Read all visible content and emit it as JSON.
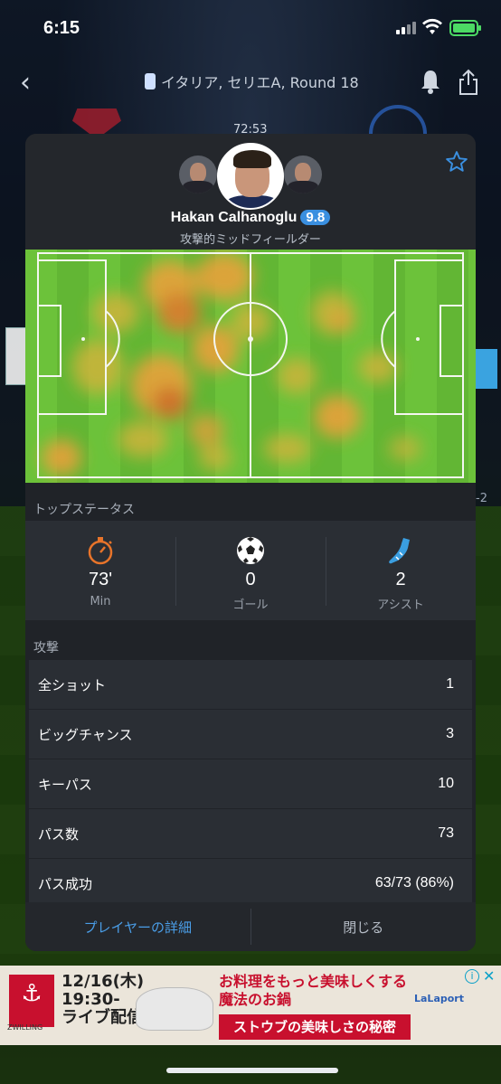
{
  "status_bar": {
    "time": "6:15"
  },
  "nav": {
    "title": "イタリア, セリエA, Round 18"
  },
  "background": {
    "clock": "72:53",
    "side_score": "-2"
  },
  "player": {
    "name": "Hakan Calhanoglu",
    "rating": "9.8",
    "position": "攻撃的ミッドフィールダー"
  },
  "top_stats": {
    "title": "トップステータス",
    "items": [
      {
        "value": "73'",
        "label": "Min",
        "icon": "stopwatch-icon"
      },
      {
        "value": "0",
        "label": "ゴール",
        "icon": "soccer-ball-icon"
      },
      {
        "value": "2",
        "label": "アシスト",
        "icon": "boot-icon"
      }
    ]
  },
  "attack": {
    "title": "攻撃",
    "rows": [
      {
        "label": "全ショット",
        "value": "1"
      },
      {
        "label": "ビッグチャンス",
        "value": "3"
      },
      {
        "label": "キーパス",
        "value": "10"
      },
      {
        "label": "パス数",
        "value": "73"
      },
      {
        "label": "パス成功",
        "value": "63/73 (86%)"
      }
    ]
  },
  "footer": {
    "details_label": "プレイヤーの詳細",
    "close_label": "閉じる"
  },
  "ad": {
    "brand": "ZWILLING",
    "date_line1": "12/16(木)",
    "date_line2": "19:30-",
    "date_line3": "ライブ配信",
    "headline1": "お料理をもっと美味しくする",
    "headline2": "魔法のお鍋",
    "banner": "ストウブの美味しさの秘密",
    "partner": "LaLaport"
  },
  "colors": {
    "accent": "#3a8fe0",
    "rating_bg": "#3a8fe0",
    "stopwatch": "#e8742a",
    "boot": "#3a9ee0"
  }
}
